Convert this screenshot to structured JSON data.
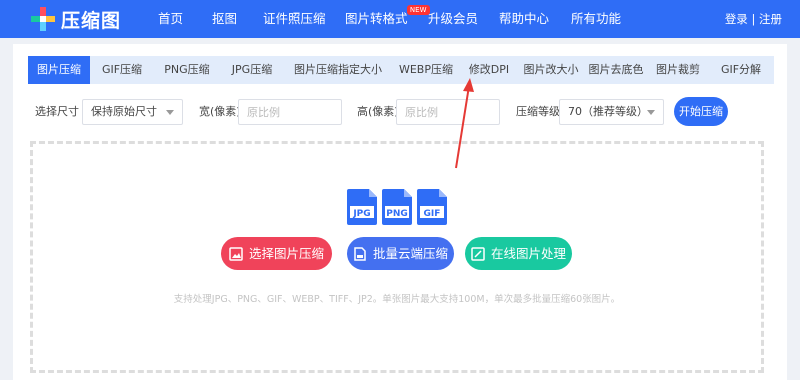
{
  "brand": {
    "name": "压缩图"
  },
  "nav": {
    "items": [
      {
        "label": "首页"
      },
      {
        "label": "抠图"
      },
      {
        "label": "证件照压缩"
      },
      {
        "label": "图片转格式",
        "badge": "NEW"
      },
      {
        "label": "升级会员"
      },
      {
        "label": "帮助中心"
      },
      {
        "label": "所有功能"
      }
    ],
    "auth": "登录 | 注册"
  },
  "tabs": [
    {
      "label": "图片压缩",
      "active": true
    },
    {
      "label": "GIF压缩"
    },
    {
      "label": "PNG压缩"
    },
    {
      "label": "JPG压缩"
    },
    {
      "label": "图片压缩指定大小"
    },
    {
      "label": "WEBP压缩"
    },
    {
      "label": "修改DPI"
    },
    {
      "label": "图片改大小"
    },
    {
      "label": "图片去底色"
    },
    {
      "label": "图片裁剪"
    },
    {
      "label": "GIF分解"
    }
  ],
  "settings": {
    "size_label": "选择尺寸",
    "size_value": "保持原始尺寸",
    "width_label": "宽(像素)",
    "width_placeholder": "原比例",
    "height_label": "高(像素)",
    "height_placeholder": "原比例",
    "level_label": "压缩等级",
    "level_value": "70（推荐等级）",
    "start_label": "开始压缩"
  },
  "upload": {
    "file_types": [
      "JPG",
      "PNG",
      "GIF"
    ],
    "buttons": [
      {
        "label": "选择图片压缩",
        "color": "#f0435a"
      },
      {
        "label": "批量云端压缩",
        "color": "#4470f0"
      },
      {
        "label": "在线图片处理",
        "color": "#19c9a0"
      }
    ],
    "hint": "支持处理JPG、PNG、GIF、WEBP、TIFF、JP2。单张图片最大支持100M，单次最多批量压缩60张图片。"
  },
  "colors": {
    "primary": "#2f6df6",
    "annotation_arrow": "#e53935"
  }
}
